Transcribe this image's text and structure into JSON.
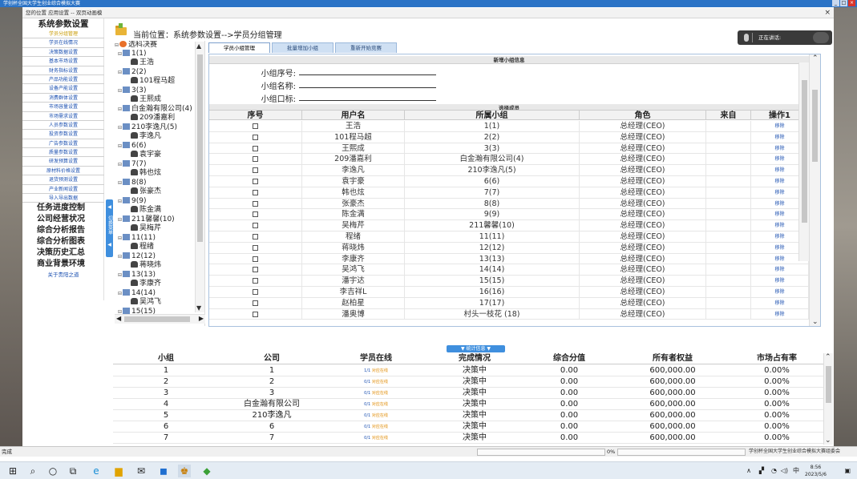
{
  "outer_window": {
    "title": "学创杯全国大学生创业综合模拟大赛",
    "controls": [
      "_",
      "□",
      "×"
    ]
  },
  "inner_window": {
    "title": "您的位置  应用设置 -- 双页动画模",
    "close": "×"
  },
  "menu": {
    "head": "系统参数设置",
    "subitems": [
      {
        "label": "学员分组管理",
        "active": true
      },
      {
        "label": "学员在线情况"
      },
      {
        "label": "决策数据设置"
      },
      {
        "label": "基本市场设置"
      },
      {
        "label": "财务指标设置"
      },
      {
        "label": "产品功能设置"
      },
      {
        "label": "设备产能设置"
      },
      {
        "label": "消费群体设置"
      },
      {
        "label": "市场容量设置"
      },
      {
        "label": "市场需求设置"
      },
      {
        "label": "人员参数设置"
      },
      {
        "label": "投资参数设置"
      },
      {
        "label": "广告参数设置"
      },
      {
        "label": "质量参数设置"
      },
      {
        "label": "研发预算设置"
      },
      {
        "label": "原材料价格设置"
      },
      {
        "label": "退货预测设置"
      },
      {
        "label": "产业新闻设置"
      },
      {
        "label": "导入导出数据"
      }
    ],
    "sections": [
      "任务进度控制",
      "公司经营状况",
      "综合分析报告",
      "综合分析图表",
      "决策历史汇总",
      "商业背景环境"
    ],
    "about": "关于贵阳之道"
  },
  "collapse_tab": "切换菜单",
  "breadcrumb": "当前位置：系统参数设置-->学员分组管理",
  "tree": {
    "root": "选科决赛",
    "nodes": [
      {
        "group": "1(1)",
        "member": "王浩"
      },
      {
        "group": "2(2)",
        "member": "101程马超"
      },
      {
        "group": "3(3)",
        "member": "王熙成"
      },
      {
        "group": "白金瀚有限公司(4)",
        "member": "209潘嘉利"
      },
      {
        "group": "210李逸凡(5)",
        "member": "李逸凡"
      },
      {
        "group": "6(6)",
        "member": "袁宇豪"
      },
      {
        "group": "7(7)",
        "member": "韩也炫"
      },
      {
        "group": "8(8)",
        "member": "张豪杰"
      },
      {
        "group": "9(9)",
        "member": "陈金满"
      },
      {
        "group": "211馨馨(10)",
        "member": "吴梅芹"
      },
      {
        "group": "11(11)",
        "member": "程绪"
      },
      {
        "group": "12(12)",
        "member": "蒋晓炜"
      },
      {
        "group": "13(13)",
        "member": "李康齐"
      },
      {
        "group": "14(14)",
        "member": "吴鸿飞"
      },
      {
        "group": "15(15)",
        "member": ""
      }
    ]
  },
  "tabs": [
    "学员小组管理",
    "批量增加小组",
    "重新开始竞赛"
  ],
  "new_group": {
    "band": "新增小组信息",
    "fields": [
      {
        "label": "小组序号:",
        "value": ""
      },
      {
        "label": "小组名称:",
        "value": ""
      },
      {
        "label": "小组口标:",
        "value": ""
      }
    ]
  },
  "members": {
    "band": "选择成员",
    "columns": [
      "序号",
      "用户名",
      "所属小组",
      "角色",
      "来自",
      "操作1"
    ],
    "rows": [
      {
        "user": "王浩",
        "group": "1(1)",
        "role": "总经理(CEO)",
        "from": "",
        "op": "移除"
      },
      {
        "user": "101程马超",
        "group": "2(2)",
        "role": "总经理(CEO)",
        "from": "",
        "op": "移除"
      },
      {
        "user": "王熙成",
        "group": "3(3)",
        "role": "总经理(CEO)",
        "from": "",
        "op": "移除"
      },
      {
        "user": "209潘嘉利",
        "group": "白金瀚有限公司(4)",
        "role": "总经理(CEO)",
        "from": "",
        "op": "移除"
      },
      {
        "user": "李逸凡",
        "group": "210李逸凡(5)",
        "role": "总经理(CEO)",
        "from": "",
        "op": "移除"
      },
      {
        "user": "袁宇豪",
        "group": "6(6)",
        "role": "总经理(CEO)",
        "from": "",
        "op": "移除"
      },
      {
        "user": "韩也炫",
        "group": "7(7)",
        "role": "总经理(CEO)",
        "from": "",
        "op": "移除"
      },
      {
        "user": "张豪杰",
        "group": "8(8)",
        "role": "总经理(CEO)",
        "from": "",
        "op": "移除"
      },
      {
        "user": "陈金满",
        "group": "9(9)",
        "role": "总经理(CEO)",
        "from": "",
        "op": "移除"
      },
      {
        "user": "吴梅芹",
        "group": "211馨馨(10)",
        "role": "总经理(CEO)",
        "from": "",
        "op": "移除"
      },
      {
        "user": "程绪",
        "group": "11(11)",
        "role": "总经理(CEO)",
        "from": "",
        "op": "移除"
      },
      {
        "user": "蒋晓炜",
        "group": "12(12)",
        "role": "总经理(CEO)",
        "from": "",
        "op": "移除"
      },
      {
        "user": "李康齐",
        "group": "13(13)",
        "role": "总经理(CEO)",
        "from": "",
        "op": "移除"
      },
      {
        "user": "吴鸿飞",
        "group": "14(14)",
        "role": "总经理(CEO)",
        "from": "",
        "op": "移除"
      },
      {
        "user": "潘宇达",
        "group": "15(15)",
        "role": "总经理(CEO)",
        "from": "",
        "op": "移除"
      },
      {
        "user": "李吉祥L",
        "group": "16(16)",
        "role": "总经理(CEO)",
        "from": "",
        "op": "移除"
      },
      {
        "user": "赵柏星",
        "group": "17(17)",
        "role": "总经理(CEO)",
        "from": "",
        "op": "移除"
      },
      {
        "user": "潘奥博",
        "group": "村头一枝花 (18)",
        "role": "总经理(CEO)",
        "from": "",
        "op": "移除"
      }
    ]
  },
  "stat_toggle": "▼ 统计信息 ▼",
  "stats": {
    "columns": [
      "小组",
      "公司",
      "学员在线",
      "完成情况",
      "综合分值",
      "所有者权益",
      "市场占有率"
    ],
    "rows": [
      {
        "group": "1",
        "company": "1",
        "online": "1/1",
        "online_note": "对应在线",
        "status": "决策中",
        "score": "0.00",
        "equity": "600,000.00",
        "share": "0.00%"
      },
      {
        "group": "2",
        "company": "2",
        "online": "0/1",
        "online_note": "对应在线",
        "status": "决策中",
        "score": "0.00",
        "equity": "600,000.00",
        "share": "0.00%"
      },
      {
        "group": "3",
        "company": "3",
        "online": "0/1",
        "online_note": "对应在线",
        "status": "决策中",
        "score": "0.00",
        "equity": "600,000.00",
        "share": "0.00%"
      },
      {
        "group": "4",
        "company": "白金瀚有限公司",
        "online": "0/1",
        "online_note": "对应在线",
        "status": "决策中",
        "score": "0.00",
        "equity": "600,000.00",
        "share": "0.00%"
      },
      {
        "group": "5",
        "company": "210李逸凡",
        "online": "0/1",
        "online_note": "对应在线",
        "status": "决策中",
        "score": "0.00",
        "equity": "600,000.00",
        "share": "0.00%"
      },
      {
        "group": "6",
        "company": "6",
        "online": "0/1",
        "online_note": "对应在线",
        "status": "决策中",
        "score": "0.00",
        "equity": "600,000.00",
        "share": "0.00%"
      },
      {
        "group": "7",
        "company": "7",
        "online": "0/1",
        "online_note": "对应在线",
        "status": "决策中",
        "score": "0.00",
        "equity": "600,000.00",
        "share": "0.00%"
      }
    ]
  },
  "chat": {
    "label": "正在讲话:"
  },
  "status_bar": {
    "left": "完成",
    "progress": "0%",
    "right": "学创杯全国大学生创业综合模拟大赛组委会"
  },
  "taskbar": {
    "ime": "中",
    "time": "8:56",
    "date": "2023/5/6"
  },
  "colors": {
    "accent": "#3f8fde",
    "link": "#1a4fb0",
    "active_menu": "#c89a00",
    "titlebar": "#2b73c6"
  }
}
